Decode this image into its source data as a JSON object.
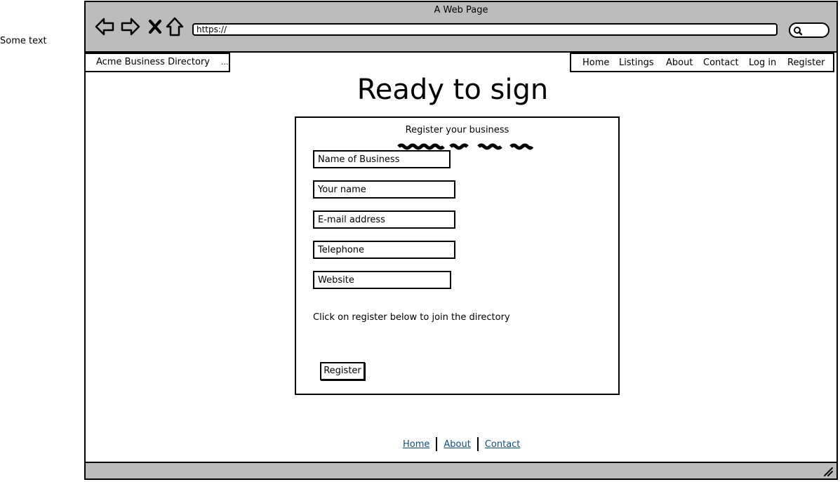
{
  "side_text": "Some text",
  "window": {
    "title": "A Web Page",
    "url": "https://"
  },
  "icons": {
    "back": "arrow-left-icon",
    "forward": "arrow-right-icon",
    "stop": "close-icon",
    "home": "home-icon",
    "search": "search-icon",
    "resize": "resize-grip-icon"
  },
  "site": {
    "brand": "Acme Business Directory",
    "brand_more": "...",
    "nav": [
      "Home",
      "Listings",
      "About",
      "Contact",
      "Log in",
      "Register"
    ]
  },
  "main": {
    "heading": "Ready to sign",
    "form": {
      "title": "Register your business",
      "fields": {
        "business": "Name of Business",
        "name": "Your name",
        "email": "E-mail address",
        "phone": "Telephone",
        "website": "Website"
      },
      "instructions": "Click on register below to join the directory",
      "submit": "Register"
    }
  },
  "footer": {
    "links": [
      "Home",
      "About",
      "Contact"
    ]
  },
  "colors": {
    "chrome": "#bcbcbc",
    "link": "#0b4f8a"
  }
}
